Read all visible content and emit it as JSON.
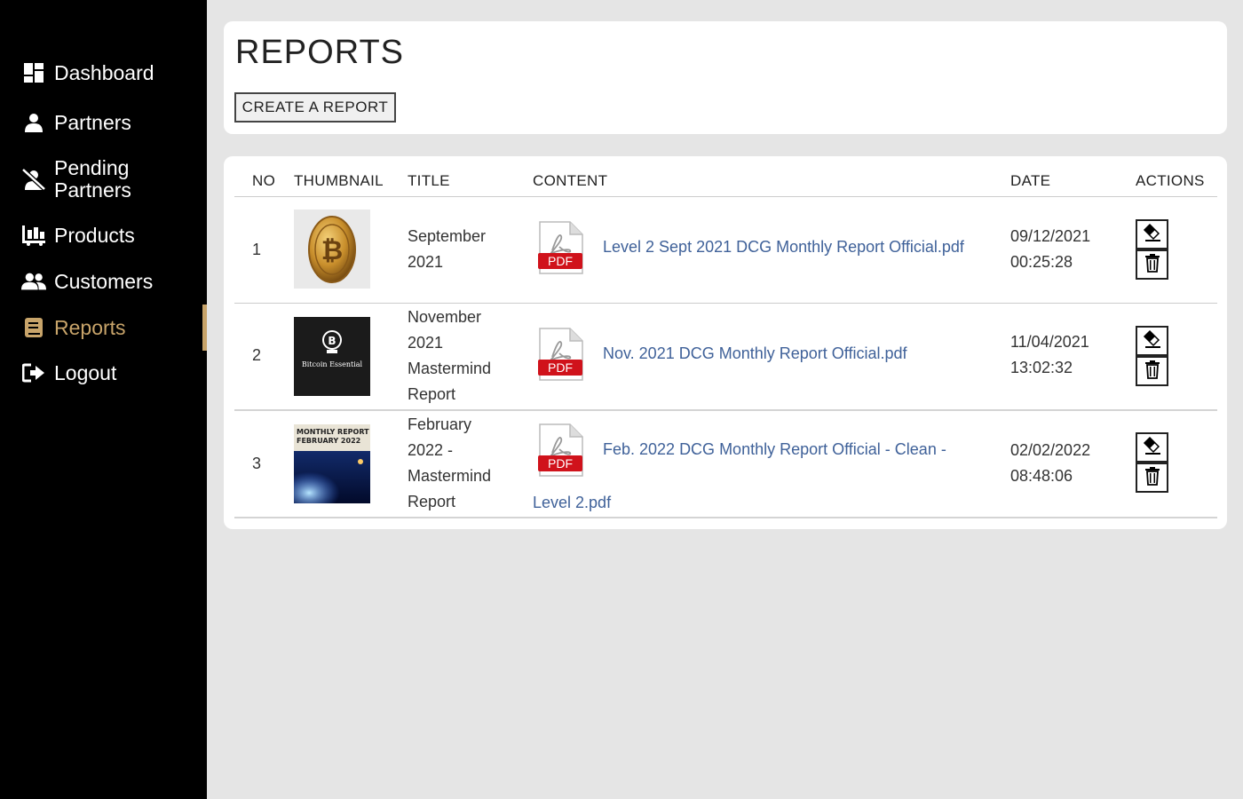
{
  "sidebar": {
    "items": [
      {
        "label": "Dashboard",
        "icon": "dashboard-icon"
      },
      {
        "label": "Partners",
        "icon": "user-icon"
      },
      {
        "label": "Pending Partners",
        "icon": "user-slash-icon"
      },
      {
        "label": "Products",
        "icon": "cart-icon"
      },
      {
        "label": "Customers",
        "icon": "users-icon"
      },
      {
        "label": "Reports",
        "icon": "book-icon",
        "active": true
      },
      {
        "label": "Logout",
        "icon": "logout-icon"
      }
    ],
    "active_color": "#c8a46a"
  },
  "header": {
    "title": "REPORTS",
    "create_label": "CREATE A REPORT"
  },
  "table": {
    "columns": [
      "NO",
      "THUMBNAIL",
      "TITLE",
      "CONTENT",
      "DATE",
      "ACTIONS"
    ],
    "rows": [
      {
        "no": "1",
        "thumbnail": "bitcoin-coin-thumbnail",
        "title": [
          "September",
          "2021"
        ],
        "file_line1": "Level 2 Sept 2021 DCG Monthly Report Official.pdf",
        "file_line2": "",
        "date": "09/12/2021",
        "time": "00:25:28"
      },
      {
        "no": "2",
        "thumbnail": "bitcoin-logo-thumbnail",
        "thumbnail_text": "Bitcoin Essential",
        "title": [
          "November",
          "2021",
          "Mastermind",
          "Report"
        ],
        "file_line1": "Nov. 2021 DCG Monthly Report Official.pdf",
        "file_line2": "",
        "date": "11/04/2021",
        "time": "13:02:32"
      },
      {
        "no": "3",
        "thumbnail": "monthly-report-thumbnail",
        "thumbnail_text": [
          "MONTHLY REPORT",
          "FEBRUARY 2022"
        ],
        "title": [
          "February",
          "2022 -",
          "Mastermind",
          "Report"
        ],
        "file_line1": "Feb. 2022 DCG Monthly Report Official - Clean -",
        "file_line2": "Level 2.pdf",
        "date": "02/02/2022",
        "time": "08:48:06"
      }
    ],
    "pdf_badge": "PDF",
    "edit_icon": "eraser-icon",
    "delete_icon": "trash-icon",
    "link_color": "#3f6199"
  }
}
